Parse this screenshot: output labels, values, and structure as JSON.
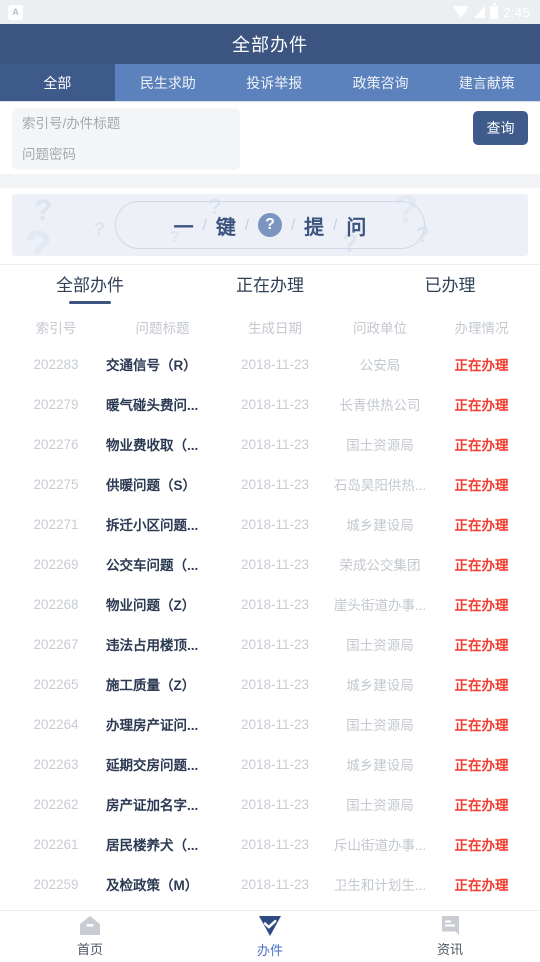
{
  "status_bar": {
    "app_badge": "A",
    "icons": [
      "wifi-icon",
      "signal-icon",
      "battery-icon"
    ],
    "time": "2:45"
  },
  "header": {
    "title": "全部办件"
  },
  "category_tabs": [
    {
      "label": "全部",
      "active": true
    },
    {
      "label": "民生求助",
      "active": false
    },
    {
      "label": "投诉举报",
      "active": false
    },
    {
      "label": "政策咨询",
      "active": false
    },
    {
      "label": "建言献策",
      "active": false
    }
  ],
  "search": {
    "index_placeholder": "索引号/办件标题",
    "index_value": "",
    "password_placeholder": "问题密码",
    "password_value": "",
    "query_button": "查询"
  },
  "banner": {
    "chars": [
      "一",
      "键",
      "?",
      "提",
      "问"
    ],
    "separator": "/",
    "badge_icon": "question-mark-icon",
    "watermark_char": "?"
  },
  "sub_tabs": [
    {
      "label": "全部办件",
      "active": true
    },
    {
      "label": "正在办理",
      "active": false
    },
    {
      "label": "已办理",
      "active": false
    }
  ],
  "table": {
    "columns": [
      "索引号",
      "问题标题",
      "生成日期",
      "问政单位",
      "办理情况"
    ],
    "rows": [
      {
        "index": "202283",
        "title": "交通信号（R）",
        "date": "2018-11-23",
        "unit": "公安局",
        "status": "正在办理"
      },
      {
        "index": "202279",
        "title": "暖气碰头费问...",
        "date": "2018-11-23",
        "unit": "长青供热公司",
        "status": "正在办理"
      },
      {
        "index": "202276",
        "title": "物业费收取（...",
        "date": "2018-11-23",
        "unit": "国土资源局",
        "status": "正在办理"
      },
      {
        "index": "202275",
        "title": "供暖问题（S）",
        "date": "2018-11-23",
        "unit": "石岛昊阳供热...",
        "status": "正在办理"
      },
      {
        "index": "202271",
        "title": "拆迁小区问题...",
        "date": "2018-11-23",
        "unit": "城乡建设局",
        "status": "正在办理"
      },
      {
        "index": "202269",
        "title": "公交车问题（...",
        "date": "2018-11-23",
        "unit": "荣成公交集团",
        "status": "正在办理"
      },
      {
        "index": "202268",
        "title": "物业问题（Z）",
        "date": "2018-11-23",
        "unit": "崖头街道办事...",
        "status": "正在办理"
      },
      {
        "index": "202267",
        "title": "违法占用楼顶...",
        "date": "2018-11-23",
        "unit": "国土资源局",
        "status": "正在办理"
      },
      {
        "index": "202265",
        "title": "施工质量（Z）",
        "date": "2018-11-23",
        "unit": "城乡建设局",
        "status": "正在办理"
      },
      {
        "index": "202264",
        "title": "办理房产证问...",
        "date": "2018-11-23",
        "unit": "国土资源局",
        "status": "正在办理"
      },
      {
        "index": "202263",
        "title": "延期交房问题...",
        "date": "2018-11-23",
        "unit": "城乡建设局",
        "status": "正在办理"
      },
      {
        "index": "202262",
        "title": "房产证加名字...",
        "date": "2018-11-23",
        "unit": "国土资源局",
        "status": "正在办理"
      },
      {
        "index": "202261",
        "title": "居民楼养犬（...",
        "date": "2018-11-23",
        "unit": "斥山街道办事...",
        "status": "正在办理"
      },
      {
        "index": "202259",
        "title": "及检政策（M）",
        "date": "2018-11-23",
        "unit": "卫生和计划生...",
        "status": "正在办理"
      }
    ]
  },
  "bottom_nav": [
    {
      "label": "首页",
      "icon": "home-icon",
      "active": false
    },
    {
      "label": "办件",
      "icon": "diamond-check-icon",
      "active": true
    },
    {
      "label": "资讯",
      "icon": "news-icon",
      "active": false
    }
  ]
}
